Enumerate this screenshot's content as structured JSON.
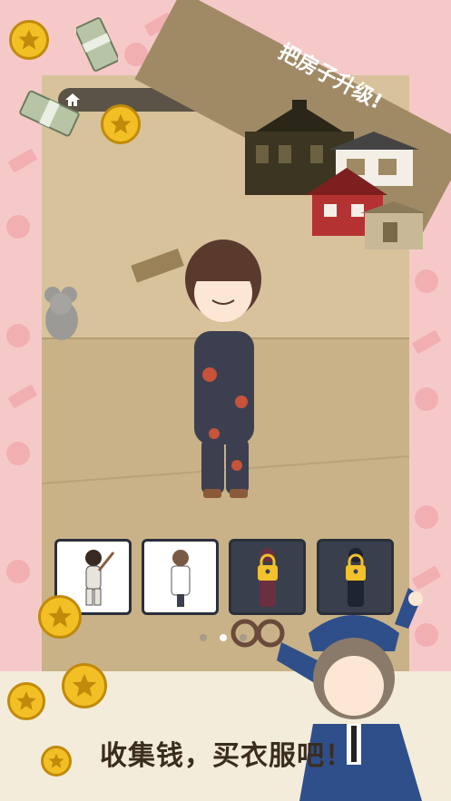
{
  "banner": {
    "title": "把房子升级!"
  },
  "footer": {
    "caption": "收集钱，买衣服吧！"
  },
  "icons": {
    "home": "home-icon",
    "lock": "lock-icon",
    "coin": "coin-icon"
  },
  "outfit_cards": [
    {
      "name": "baseball-outfit",
      "locked": false
    },
    {
      "name": "doctor-outfit",
      "locked": false
    },
    {
      "name": "school-uniform-outfit",
      "locked": true
    },
    {
      "name": "dark-outfit",
      "locked": true
    }
  ],
  "pager": {
    "pages": 3,
    "current": 2
  },
  "colors": {
    "background_pink": "#f6c9c9",
    "banner_brown": "#a08a66",
    "coin_gold": "#f2c025",
    "card_border": "#2b2f3b",
    "lock_yellow": "#f3c12b"
  }
}
